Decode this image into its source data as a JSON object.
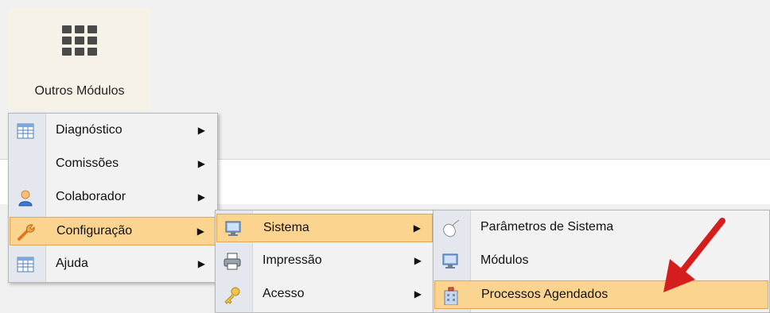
{
  "module": {
    "label": "Outros Módulos",
    "icon": "grid-icon"
  },
  "menu_main": {
    "items": [
      {
        "label": "Diagnóstico",
        "icon": "spreadsheet-icon",
        "has_submenu": true
      },
      {
        "label": "Comissões",
        "icon": "",
        "has_submenu": true
      },
      {
        "label": "Colaborador",
        "icon": "user-icon",
        "has_submenu": true
      },
      {
        "label": "Configuração",
        "icon": "wrench-icon",
        "has_submenu": true,
        "active": true
      },
      {
        "label": "Ajuda",
        "icon": "spreadsheet-icon",
        "has_submenu": true
      }
    ]
  },
  "menu_config": {
    "items": [
      {
        "label": "Sistema",
        "icon": "monitor-icon",
        "has_submenu": true,
        "active": true
      },
      {
        "label": "Impressão",
        "icon": "printer-icon",
        "has_submenu": true
      },
      {
        "label": "Acesso",
        "icon": "key-icon",
        "has_submenu": true
      }
    ]
  },
  "menu_sistema": {
    "items": [
      {
        "label": "Parâmetros de Sistema",
        "icon": "mouse-icon"
      },
      {
        "label": "Módulos",
        "icon": "monitor-icon"
      },
      {
        "label": "Processos Agendados",
        "icon": "building-icon",
        "active": true
      }
    ]
  },
  "annotation": {
    "icon": "red-arrow-icon",
    "color": "#d61d1d"
  },
  "colors": {
    "highlight": "#fbd48f",
    "highlight_border": "#e3a64a",
    "tile_bg": "#f7f2e8"
  }
}
